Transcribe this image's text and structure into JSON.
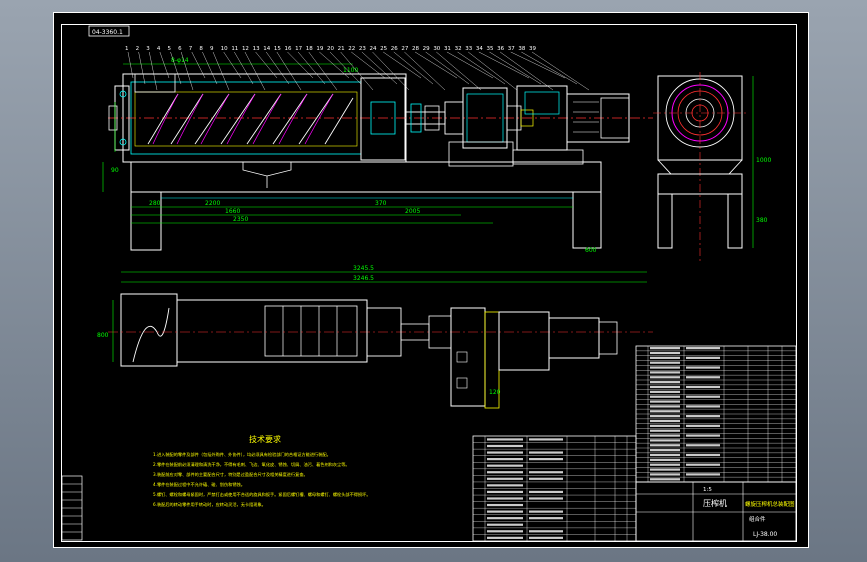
{
  "drawing": {
    "frame_tag": "04-3360.1",
    "tech_title": "技术要求",
    "tech_notes": [
      "1.进入装配的零件及部件（包括外购件、外协件），均必须具有检验部门的合格证方能进行装配。",
      "2.零件在装配前必须清理和清洗干净，不得有毛刺、飞边、氧化皮、锈蚀、切屑、油污、着色剂和灰尘等。",
      "3.装配前应对零、部件的主要配合尺寸，特别是过盈配合尺寸及相关精度进行复查。",
      "4.零件在装配过程中不允许磕、碰、划伤和锈蚀。",
      "5.螺钉、螺栓和螺母紧固时，严禁打击或使用不合适的旋具和扳手。紧固后螺钉槽、螺母和螺钉、螺栓头部不得损坏。",
      "6.装配后的转动零件用手转动时，应转动灵活，无卡阻现象。"
    ],
    "title_block": {
      "name": "压榨机",
      "company": "螺旋压榨机总装配图",
      "drawing_no": "LJ-38.00",
      "scale": "1:5",
      "material": "组合件"
    },
    "dims": {
      "total_top": "3245.5",
      "total_bottom": "3246.5",
      "screw": "8-φ14",
      "d1100": "1100",
      "d2200": "2200",
      "d2350": "2350",
      "d280": "280",
      "d370": "370",
      "d2005": "2005",
      "d1660": "1660",
      "d90": "90",
      "d380": "380",
      "d1000": "1000",
      "d80": "80",
      "d600": "600",
      "d800": "800",
      "d120": "120"
    },
    "labels": {
      "pos_numbers": [
        "1",
        "2",
        "3",
        "4",
        "5",
        "6",
        "7",
        "8",
        "9",
        "10",
        "11",
        "12",
        "13",
        "14",
        "15",
        "16",
        "17",
        "18",
        "19",
        "20",
        "21",
        "22",
        "23",
        "24",
        "25",
        "26",
        "27",
        "28",
        "29",
        "30",
        "31",
        "32",
        "33",
        "34",
        "35",
        "36",
        "37",
        "38",
        "39"
      ],
      "bom_rows": 28,
      "bom2_rows": 16
    },
    "colors": {
      "frame": "#ffffff",
      "cyan": "#00ffff",
      "yellow": "#ffff00",
      "green": "#00ff00",
      "red": "#ff3030",
      "magenta": "#ff00ff",
      "orange": "#ff8000"
    }
  }
}
